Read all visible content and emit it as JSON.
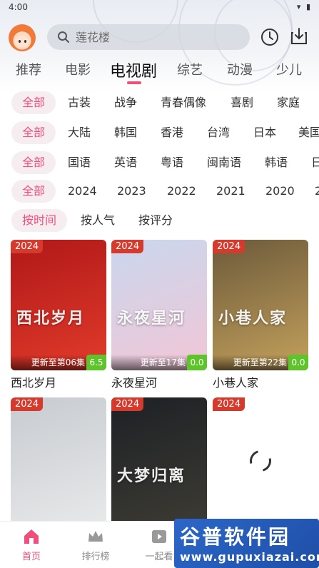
{
  "status": {
    "time": "4:00",
    "icons": "▾ ▮"
  },
  "search": {
    "placeholder": "莲花楼"
  },
  "category_tabs": [
    "推荐",
    "电影",
    "电视剧",
    "综艺",
    "动漫",
    "少儿"
  ],
  "active_category": "电视剧",
  "filters": {
    "genre": [
      "全部",
      "古装",
      "战争",
      "青春偶像",
      "喜剧",
      "家庭"
    ],
    "region": [
      "全部",
      "大陆",
      "韩国",
      "香港",
      "台湾",
      "日本",
      "美国"
    ],
    "language": [
      "全部",
      "国语",
      "英语",
      "粤语",
      "闽南语",
      "韩语",
      "日"
    ],
    "year": [
      "全部",
      "2024",
      "2023",
      "2022",
      "2021",
      "2020",
      "2"
    ],
    "sort": [
      "按时间",
      "按人气",
      "按评分"
    ]
  },
  "items": [
    {
      "year": "2024",
      "update": "更新至第06集",
      "score": "6.5",
      "title": "西北岁月",
      "poster_text": "西北岁月",
      "palette": [
        "#b01818",
        "#e23b2b"
      ]
    },
    {
      "year": "2024",
      "update": "更新至17集",
      "score": "0.0",
      "title": "永夜星河",
      "poster_text": "永夜星河",
      "palette": [
        "#c9d7ee",
        "#f2c6d6"
      ]
    },
    {
      "year": "2024",
      "update": "更新至第22集",
      "score": "0.0",
      "title": "小巷人家",
      "poster_text": "小巷人家",
      "palette": [
        "#6c5a3b",
        "#c4a15c"
      ]
    },
    {
      "year": "2024",
      "update": "",
      "score": "",
      "title": "",
      "poster_text": "",
      "palette": [
        "#c7cbd0",
        "#e8e9ea"
      ]
    },
    {
      "year": "2024",
      "update": "",
      "score": "",
      "title": "",
      "poster_text": "大梦归离",
      "palette": [
        "#1d2125",
        "#3d3b34"
      ]
    },
    {
      "year": "2024",
      "update": "",
      "score": "",
      "title": "",
      "poster_text": "",
      "palette": [
        "#ffffff",
        "#ffffff"
      ]
    }
  ],
  "bottom_nav": [
    {
      "label": "首页",
      "icon": "home-icon",
      "active": true
    },
    {
      "label": "排行榜",
      "icon": "crown-icon",
      "active": false
    },
    {
      "label": "一起看",
      "icon": "play-icon",
      "active": false
    }
  ],
  "watermark": {
    "line1": "谷普软件园",
    "line2": "www.gupuxiazai.com"
  },
  "colors": {
    "accent": "#ef4f7a",
    "year_badge": "#d63a2c",
    "score_badge": "#5dc52a"
  }
}
